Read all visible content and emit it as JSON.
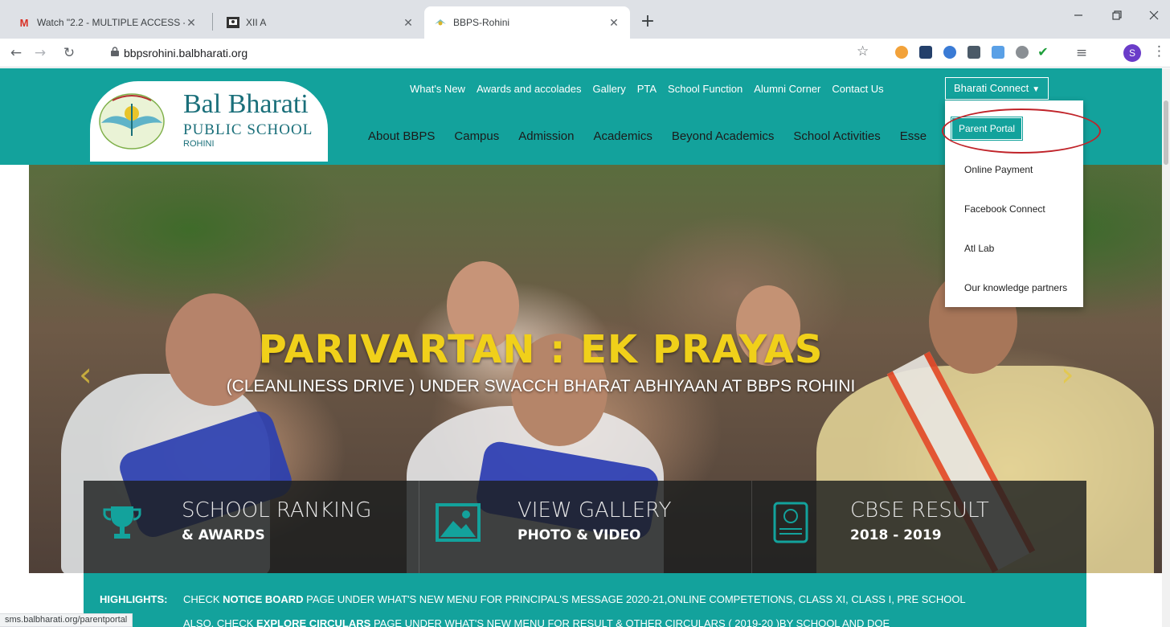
{
  "browser": {
    "tabs": [
      {
        "title": "Watch \"2.2 - MULTIPLE ACCESS -",
        "icon": "gmail-icon"
      },
      {
        "title": "XII A",
        "icon": "classroom-icon"
      },
      {
        "title": "BBPS-Rohini",
        "icon": "site-favicon"
      }
    ],
    "close_glyph": "✕",
    "new_tab_glyph": "+",
    "url": "bbpsrohini.balbharati.org",
    "profile_initial": "S",
    "status_url": "sms.balbharati.org/parentportal"
  },
  "site": {
    "logo": {
      "name": "Bal Bharati",
      "sub": "PUBLIC SCHOOL",
      "city": "ROHINI"
    },
    "top_nav": [
      "What's New",
      "Awards and accolades",
      "Gallery",
      "PTA",
      "School Function",
      "Alumni Corner",
      "Contact Us"
    ],
    "connect_label": "Bharati Connect",
    "main_nav": [
      "About BBPS",
      "Campus",
      "Admission",
      "Academics",
      "Beyond Academics",
      "School Activities",
      "Esse"
    ],
    "dropdown": [
      "Parent Portal",
      "Online Payment",
      "Facebook Connect",
      "Atl Lab",
      "Our knowledge partners"
    ],
    "hero": {
      "title": "PARIVARTAN : EK PRAYAS",
      "subtitle": "(CLEANLINESS DRIVE ) UNDER SWACCH BHARAT ABHIYAAN AT BBPS ROHINI"
    },
    "features": [
      {
        "main": "SCHOOL RANKING",
        "sub": "& AWARDS",
        "icon": "trophy-icon"
      },
      {
        "main": "VIEW GALLERY",
        "sub": "PHOTO & VIDEO",
        "icon": "gallery-icon"
      },
      {
        "main": "CBSE RESULT",
        "sub": "2018 - 2019",
        "icon": "result-icon"
      }
    ],
    "highlights": {
      "label": "HIGHLIGHTS:",
      "line1_pre": "CHECK ",
      "line1_bold": "NOTICE BOARD",
      "line1_post": " PAGE UNDER WHAT'S NEW MENU FOR PRINCIPAL'S MESSAGE 2020-21,ONLINE COMPETETIONS, CLASS XI, CLASS I,  PRE SCHOOL",
      "line2_pre": "ALSO, CHECK ",
      "line2_bold": "EXPLORE CIRCULARS",
      "line2_post": " PAGE UNDER WHAT'S NEW MENU FOR RESULT & OTHER CIRCULARS ( 2019-20 )BY SCHOOL AND DOE"
    },
    "colors": {
      "brand_teal": "#13a29c",
      "title_yellow": "#f0d01a",
      "annotation_red": "#c0242a"
    }
  }
}
